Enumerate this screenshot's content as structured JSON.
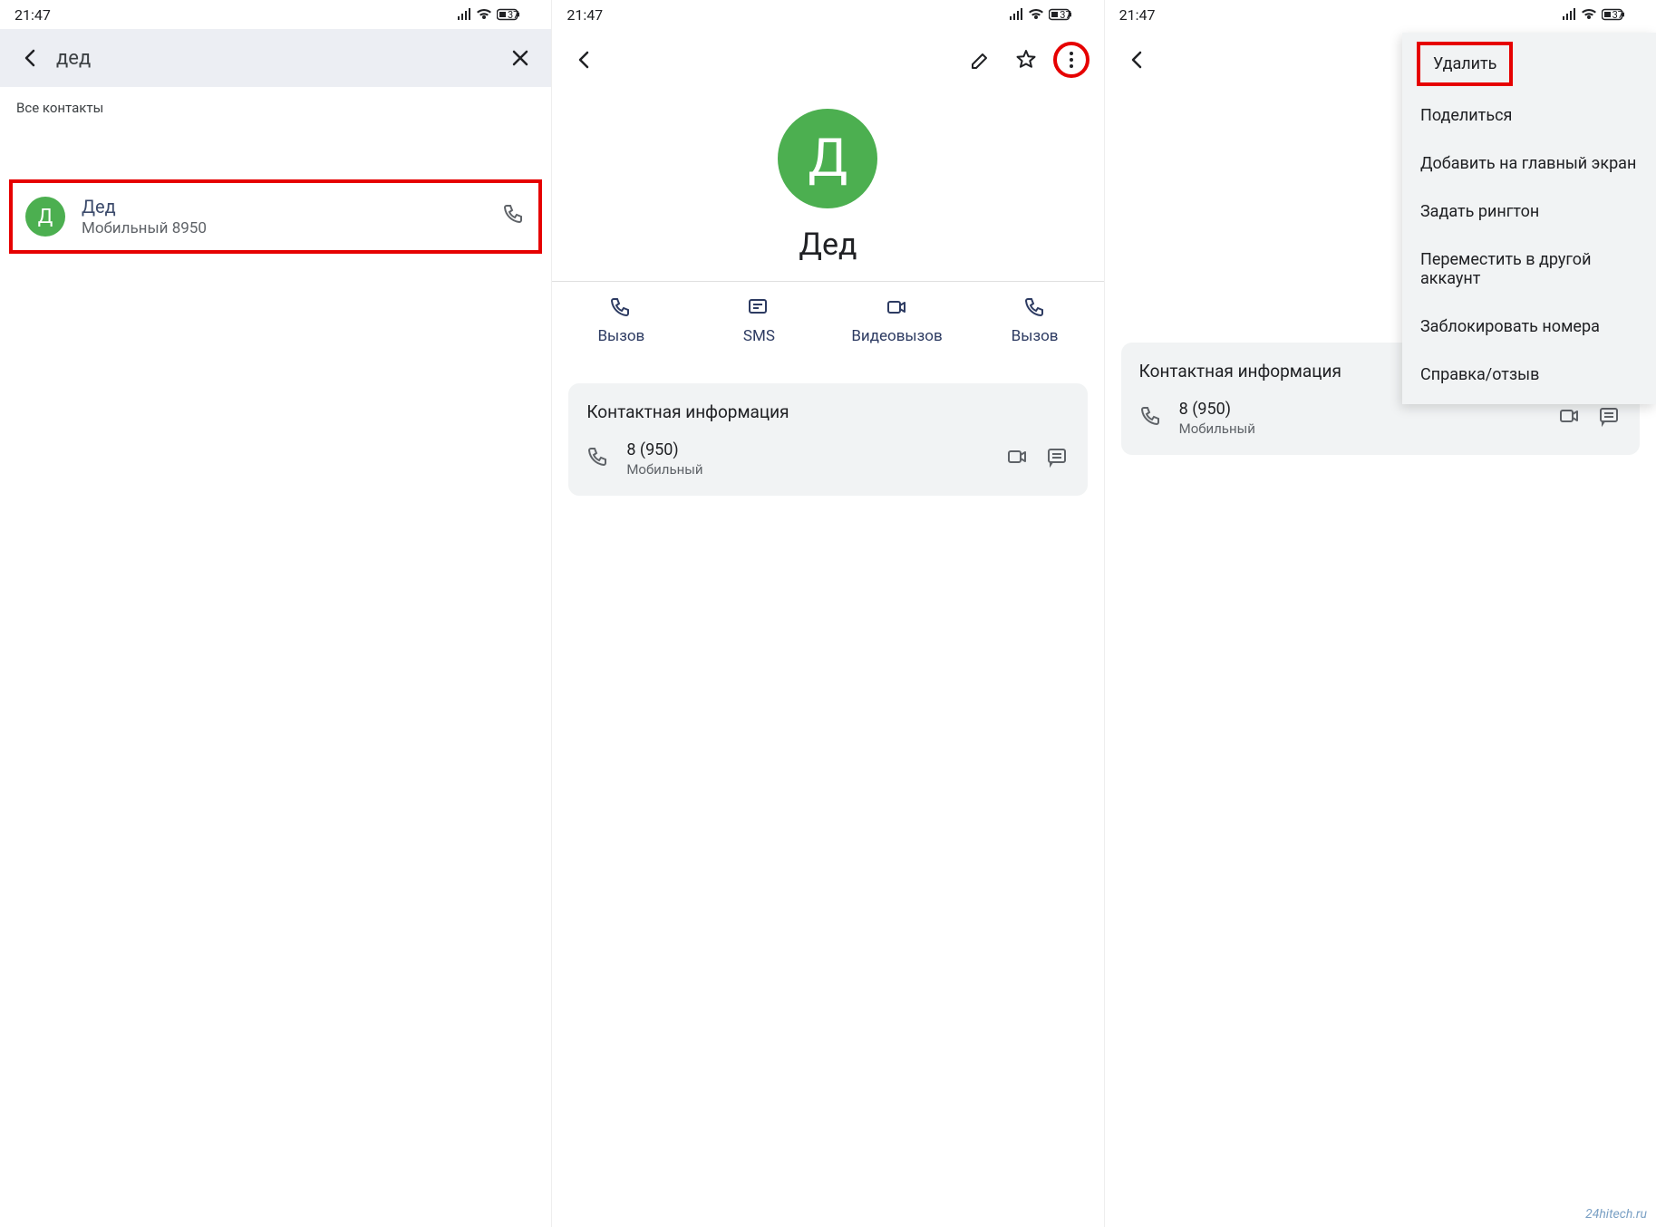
{
  "status": {
    "time": "21:47",
    "battery": "37"
  },
  "pane1": {
    "query": "дед",
    "section": "Все контакты",
    "contact": {
      "initial": "Д",
      "name": "Дед",
      "sub": "Мобильный 8950"
    }
  },
  "pane2": {
    "initial": "Д",
    "name": "Дед",
    "actions": {
      "call": "Вызов",
      "sms": "SMS",
      "video": "Видеовызов",
      "call2": "Вызов"
    },
    "info_title": "Контактная информация",
    "phone": {
      "number": "8 (950)",
      "type": "Мобильный"
    }
  },
  "pane3": {
    "info_title": "Контактная информация",
    "phone": {
      "number": "8 (950)",
      "type": "Мобильный"
    },
    "menu": {
      "delete": "Удалить",
      "share": "Поделиться",
      "add_home": "Добавить на главный экран",
      "ringtone": "Задать рингтон",
      "move_account": "Переместить в другой аккаунт",
      "block": "Заблокировать номера",
      "help": "Справка/отзыв"
    }
  },
  "watermark": "24hitech.ru"
}
